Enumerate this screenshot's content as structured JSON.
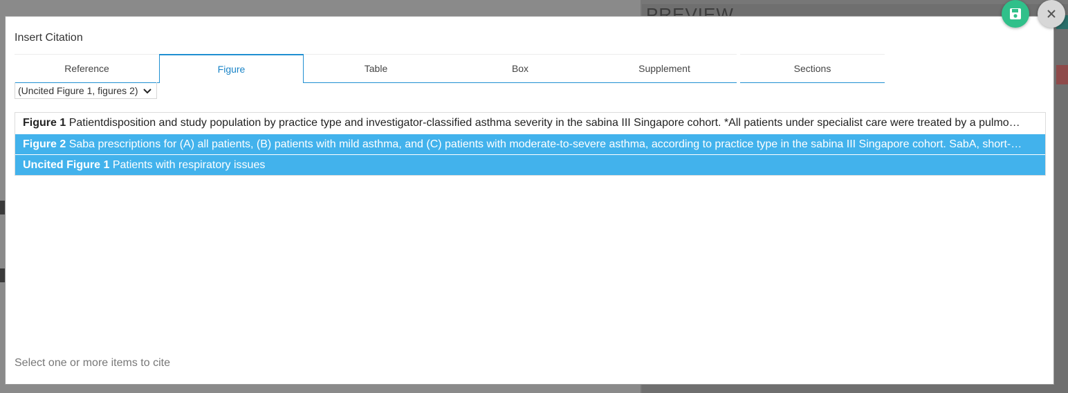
{
  "background": {
    "preview_title": "PREVIEW"
  },
  "modal": {
    "title": "Insert Citation",
    "tabs": [
      {
        "label": "Reference",
        "active": false
      },
      {
        "label": "Figure",
        "active": true
      },
      {
        "label": "Table",
        "active": false
      },
      {
        "label": "Box",
        "active": false
      },
      {
        "label": "Supplement",
        "active": false
      },
      {
        "label": "Sections",
        "active": false
      }
    ],
    "filter": {
      "selected": "(Uncited Figure 1, figures 2)"
    },
    "items": [
      {
        "label": "Figure 1",
        "text": "Patientdisposition and study population by practice type and investigator-classified asthma severity in the sabina III Singapore cohort. *All patients under specialist care were treated by a pulmo…",
        "selected": false
      },
      {
        "label": "Figure 2",
        "text": "Saba prescriptions for (A) all patients, (B) patients with mild asthma, and (C) patients with moderate-to-severe asthma, according to practice type in the sabina III Singapore cohort. SabA, short-…",
        "selected": true
      },
      {
        "label": "Uncited Figure 1",
        "text": "Patients with respiratory issues",
        "selected": true
      }
    ],
    "hint": "Select one or more items to cite"
  },
  "buttons": {
    "save_icon": "floppy-disk-icon",
    "close_icon": "close-icon"
  },
  "colors": {
    "accent": "#1f8fd1",
    "selected_row": "#42b2ec",
    "save_button": "#30c08a",
    "close_button": "#d7d7d7"
  }
}
